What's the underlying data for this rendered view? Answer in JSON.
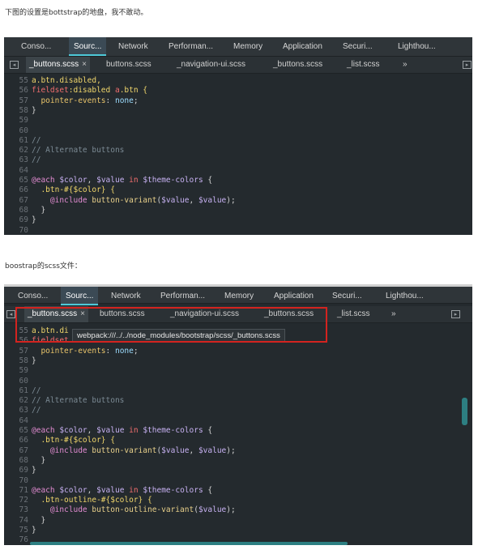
{
  "caption_top": "下图的设置是bottstrap的地盘，我不敢动。",
  "caption_mid": "boostrap的scss文件：",
  "devtools_tabs": [
    "Conso...",
    "Sourc...",
    "Network",
    "Performan...",
    "Memory",
    "Application",
    "Securi...",
    "Lighthou..."
  ],
  "file_tabs": [
    "_buttons.scss",
    "buttons.scss",
    "_navigation-ui.scss",
    "_buttons.scss",
    "_list.scss",
    "»"
  ],
  "close_glyph": "×",
  "tooltip_path": "webpack:///../../node_modules/bootstrap/scss/_buttons.scss",
  "panel1_lines": [
    {
      "n": "55",
      "parts": [
        [
          "c-sel",
          "a.btn.disabled,"
        ]
      ]
    },
    {
      "n": "56",
      "parts": [
        [
          "c-kw",
          "fieldset"
        ],
        [
          "c-sel",
          ":disabled "
        ],
        [
          "c-kw",
          "a"
        ],
        [
          "c-sel",
          ".btn {"
        ]
      ]
    },
    {
      "n": "57",
      "parts": [
        [
          "c-prop",
          "  pointer-events"
        ],
        [
          "c-punc",
          ": "
        ],
        [
          "c-val",
          "none"
        ],
        [
          "c-punc",
          ";"
        ]
      ]
    },
    {
      "n": "58",
      "parts": [
        [
          "c-punc",
          "}"
        ]
      ]
    },
    {
      "n": "59",
      "parts": []
    },
    {
      "n": "60",
      "parts": []
    },
    {
      "n": "61",
      "parts": [
        [
          "c-cmt",
          "//"
        ]
      ]
    },
    {
      "n": "62",
      "parts": [
        [
          "c-cmt",
          "// Alternate buttons"
        ]
      ]
    },
    {
      "n": "63",
      "parts": [
        [
          "c-cmt",
          "//"
        ]
      ]
    },
    {
      "n": "64",
      "parts": []
    },
    {
      "n": "65",
      "parts": [
        [
          "c-at",
          "@each "
        ],
        [
          "c-var",
          "$color"
        ],
        [
          "c-punc",
          ", "
        ],
        [
          "c-var",
          "$value"
        ],
        [
          "c-kw",
          " in "
        ],
        [
          "c-var",
          "$theme-colors"
        ],
        [
          "c-punc",
          " {"
        ]
      ]
    },
    {
      "n": "66",
      "parts": [
        [
          "c-sel",
          "  .btn-#{$color} {"
        ]
      ]
    },
    {
      "n": "67",
      "parts": [
        [
          "c-at",
          "    @include "
        ],
        [
          "c-fn",
          "button-variant"
        ],
        [
          "c-punc",
          "("
        ],
        [
          "c-var",
          "$value"
        ],
        [
          "c-punc",
          ", "
        ],
        [
          "c-var",
          "$value"
        ],
        [
          "c-punc",
          ");"
        ]
      ]
    },
    {
      "n": "68",
      "parts": [
        [
          "c-punc",
          "  }"
        ]
      ]
    },
    {
      "n": "69",
      "parts": [
        [
          "c-punc",
          "}"
        ]
      ]
    },
    {
      "n": "70",
      "parts": []
    }
  ],
  "panel2_lines": [
    {
      "n": "55",
      "parts": [
        [
          "c-sel",
          "a.btn.di"
        ]
      ]
    },
    {
      "n": "56",
      "parts": [
        [
          "c-kw",
          "fieldset"
        ]
      ]
    },
    {
      "n": "57",
      "parts": [
        [
          "c-prop",
          "  pointer-events"
        ],
        [
          "c-punc",
          ": "
        ],
        [
          "c-val",
          "none"
        ],
        [
          "c-punc",
          ";"
        ]
      ]
    },
    {
      "n": "58",
      "parts": [
        [
          "c-punc",
          "}"
        ]
      ]
    },
    {
      "n": "59",
      "parts": []
    },
    {
      "n": "60",
      "parts": []
    },
    {
      "n": "61",
      "parts": [
        [
          "c-cmt",
          "//"
        ]
      ]
    },
    {
      "n": "62",
      "parts": [
        [
          "c-cmt",
          "// Alternate buttons"
        ]
      ]
    },
    {
      "n": "63",
      "parts": [
        [
          "c-cmt",
          "//"
        ]
      ]
    },
    {
      "n": "64",
      "parts": []
    },
    {
      "n": "65",
      "parts": [
        [
          "c-at",
          "@each "
        ],
        [
          "c-var",
          "$color"
        ],
        [
          "c-punc",
          ", "
        ],
        [
          "c-var",
          "$value"
        ],
        [
          "c-kw",
          " in "
        ],
        [
          "c-var",
          "$theme-colors"
        ],
        [
          "c-punc",
          " {"
        ]
      ]
    },
    {
      "n": "66",
      "parts": [
        [
          "c-sel",
          "  .btn-#{$color} {"
        ]
      ]
    },
    {
      "n": "67",
      "parts": [
        [
          "c-at",
          "    @include "
        ],
        [
          "c-fn",
          "button-variant"
        ],
        [
          "c-punc",
          "("
        ],
        [
          "c-var",
          "$value"
        ],
        [
          "c-punc",
          ", "
        ],
        [
          "c-var",
          "$value"
        ],
        [
          "c-punc",
          ");"
        ]
      ]
    },
    {
      "n": "68",
      "parts": [
        [
          "c-punc",
          "  }"
        ]
      ]
    },
    {
      "n": "69",
      "parts": [
        [
          "c-punc",
          "}"
        ]
      ]
    },
    {
      "n": "70",
      "parts": []
    },
    {
      "n": "71",
      "parts": [
        [
          "c-at",
          "@each "
        ],
        [
          "c-var",
          "$color"
        ],
        [
          "c-punc",
          ", "
        ],
        [
          "c-var",
          "$value"
        ],
        [
          "c-kw",
          " in "
        ],
        [
          "c-var",
          "$theme-colors"
        ],
        [
          "c-punc",
          " {"
        ]
      ]
    },
    {
      "n": "72",
      "parts": [
        [
          "c-sel",
          "  .btn-outline-#{$color} {"
        ]
      ]
    },
    {
      "n": "73",
      "parts": [
        [
          "c-at",
          "    @include "
        ],
        [
          "c-fn",
          "button-outline-variant"
        ],
        [
          "c-punc",
          "("
        ],
        [
          "c-var",
          "$value"
        ],
        [
          "c-punc",
          ");"
        ]
      ]
    },
    {
      "n": "74",
      "parts": [
        [
          "c-punc",
          "  }"
        ]
      ]
    },
    {
      "n": "75",
      "parts": [
        [
          "c-punc",
          "}"
        ]
      ]
    },
    {
      "n": "76",
      "parts": []
    }
  ]
}
